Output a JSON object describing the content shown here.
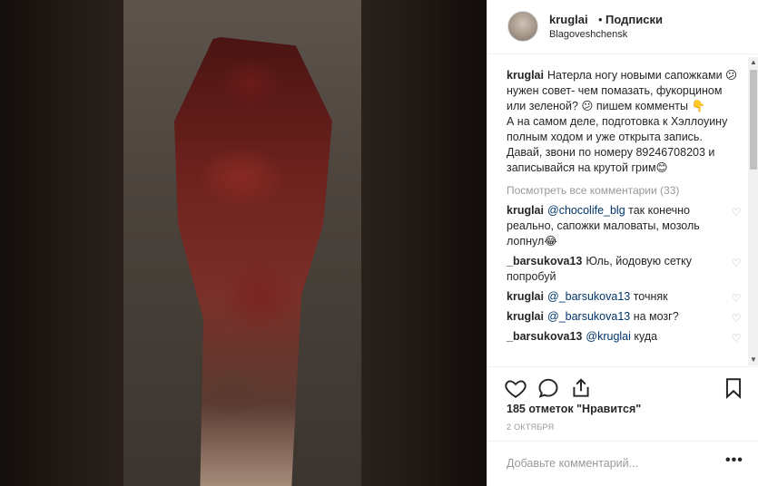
{
  "header": {
    "username": "kruglai",
    "separator": "•",
    "follow_label": "Подписки",
    "location": "Blagoveshchensk"
  },
  "caption": {
    "username": "kruglai",
    "lines": [
      "Натерла ногу новыми сапожками 😕 нужен совет- чем помазать, фукорцином или зеленой? 😕 пишем комменты 👇",
      "А на самом деле, подготовка к Хэллоуину полным ходом и уже открыта запись.",
      "Давай, звони по номеру 89246708203 и записывайся на крутой грим😊"
    ]
  },
  "view_all_comments": "Посмотреть все комментарии (33)",
  "comments": [
    {
      "user": "kruglai",
      "mention": "@chocolife_blg",
      "text": " так конечно реально, сапожки маловаты, мозоль лопнул😂"
    },
    {
      "user": "_barsukova13",
      "mention": "",
      "text": "Юль, йодовую сетку попробуй"
    },
    {
      "user": "kruglai",
      "mention": "@_barsukova13",
      "text": " точняк"
    },
    {
      "user": "kruglai",
      "mention": "@_barsukova13",
      "text": " на мозг?"
    },
    {
      "user": "_barsukova13",
      "mention": "@kruglai",
      "text": " куда"
    }
  ],
  "icons": {
    "like": "heart-icon",
    "comment": "comment-icon",
    "share": "share-icon",
    "save": "bookmark-icon",
    "comment_like": "small-heart-icon",
    "more": "more-options-icon"
  },
  "likes_text": "185 отметок \"Нравится\"",
  "date_text": "2 ОКТЯБРЯ",
  "add_comment_placeholder": "Добавьте комментарий...",
  "more_dots": "•••",
  "colors": {
    "link": "#003569",
    "muted": "#999999",
    "text": "#262626"
  }
}
